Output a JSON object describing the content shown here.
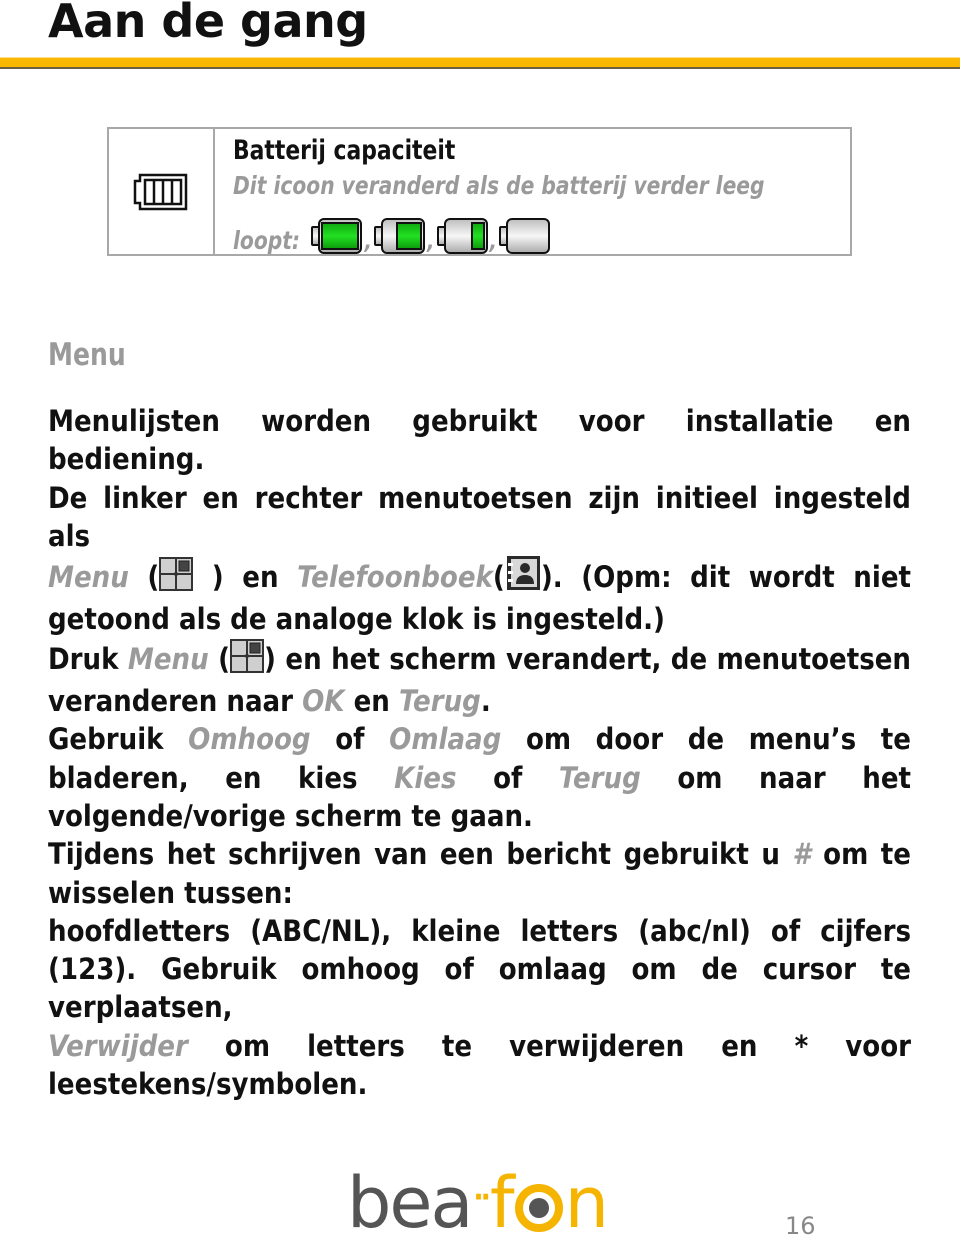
{
  "page": {
    "title": "Aan de gang",
    "page_number": "16",
    "accent_color": "#fbb800",
    "highlight_color": "#9a9a9a"
  },
  "battery_table": {
    "icon": "battery-full-outline-icon",
    "title": "Batterij capaciteit",
    "description": "Dit icoon veranderd als de batterij verder leeg",
    "levels_label": "loopt:",
    "levels": [
      {
        "icon": "battery-full-icon",
        "fill": 1.0
      },
      {
        "icon": "battery-two-thirds-icon",
        "fill": 0.66
      },
      {
        "icon": "battery-one-third-icon",
        "fill": 0.33
      },
      {
        "icon": "battery-empty-icon",
        "fill": 0.0
      }
    ],
    "separator": ","
  },
  "menu_section": {
    "heading": "Menu",
    "p1": "Menulijsten worden gebruikt voor installatie en bediening.",
    "p2_a": "De linker en rechter menutoetsen zijn initieel ingesteld als",
    "p2_menu": "Menu",
    "p2_b": " (",
    "p2_c": " ) en ",
    "p2_phonebook": "Telefoonboek",
    "p2_d": "(",
    "p2_e": "). (Opm: dit wordt niet",
    "p2_f": "getoond als de analoge klok is ingesteld.)",
    "p3_a": "Druk ",
    "p3_menu": "Menu",
    "p3_b": " (",
    "p3_c": ") en  het scherm verandert, de menutoetsen",
    "p3_d": "veranderen naar ",
    "p3_ok": "OK",
    "p3_e": " en ",
    "p3_back": "Terug",
    "p3_f": ".",
    "p4_a": "Gebruik ",
    "p4_up": "Omhoog",
    "p4_b": " of ",
    "p4_down": "Omlaag",
    "p4_c": "  om door de menu’s te",
    "p4_d": "bladeren, en kies ",
    "p4_select": "Kies",
    "p4_e": " of ",
    "p4_back": "Terug",
    "p4_f": " om naar het",
    "p4_g": "volgende/vorige scherm te gaan.",
    "p5_a": "Tijdens het schrijven van een bericht gebruikt u ",
    "p5_hash": "#",
    "p5_b": " om te",
    "p5_c": "wisselen tussen:",
    "p6_a": "hoofdletters (ABC/NL), kleine letters (abc/nl) of cijfers",
    "p6_b": "(123). Gebruik omhoog of omlaag om de cursor te",
    "p6_c": "verplaatsen,",
    "p7_delete": "Verwijder",
    "p7_a": " om letters te verwijderen en * voor",
    "p7_b": "leestekens/symbolen.",
    "menu_icon": "menu-grid-icon",
    "phonebook_icon": "phonebook-contact-icon"
  },
  "logo": {
    "part1": "bea",
    "dots": "··",
    "part2_f": "f",
    "part2_n": "n",
    "brand_gray": "#555555",
    "brand_yellow": "#f5b400"
  }
}
